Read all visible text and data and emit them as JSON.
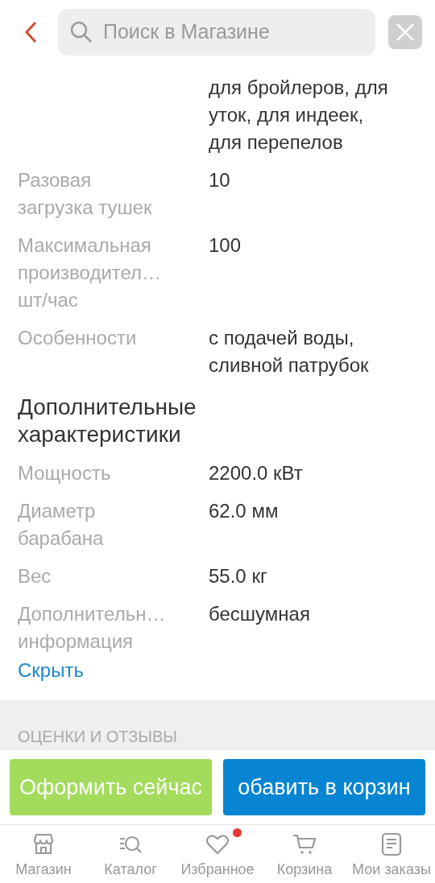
{
  "search": {
    "placeholder": "Поиск в Магазине"
  },
  "specs": [
    {
      "value": "для бройлеров, для уток, для индеек, для перепелов"
    },
    {
      "label": "Разовая загрузка тушек",
      "value": "10"
    },
    {
      "label": "Максимальная производител… шт/час",
      "value": "100"
    },
    {
      "label": "Особенности",
      "value": "с подачей воды, сливной патрубок"
    }
  ],
  "extra": {
    "title": "Дополнительные характеристики",
    "rows": [
      {
        "label": "Мощность",
        "value": "2200.0 кВт"
      },
      {
        "label": "Диаметр барабана",
        "value": "62.0 мм"
      },
      {
        "label": "Вес",
        "value": "55.0 кг"
      },
      {
        "label": "Дополнительн… информация",
        "value": "бесшумная"
      }
    ],
    "hide_link": "Скрыть"
  },
  "reviews_heading": "ОЦЕНКИ И ОТЗЫВЫ",
  "buttons": {
    "buy": "Оформить сейчас",
    "add": "обавить в корзин"
  },
  "nav": [
    {
      "kind": "store",
      "label": "Магазин",
      "badge": false
    },
    {
      "kind": "catalog",
      "label": "Каталог",
      "badge": false
    },
    {
      "kind": "favorites",
      "label": "Избранное",
      "badge": true
    },
    {
      "kind": "cart",
      "label": "Корзина",
      "badge": false
    },
    {
      "kind": "orders",
      "label": "Мои заказы",
      "badge": false
    }
  ]
}
